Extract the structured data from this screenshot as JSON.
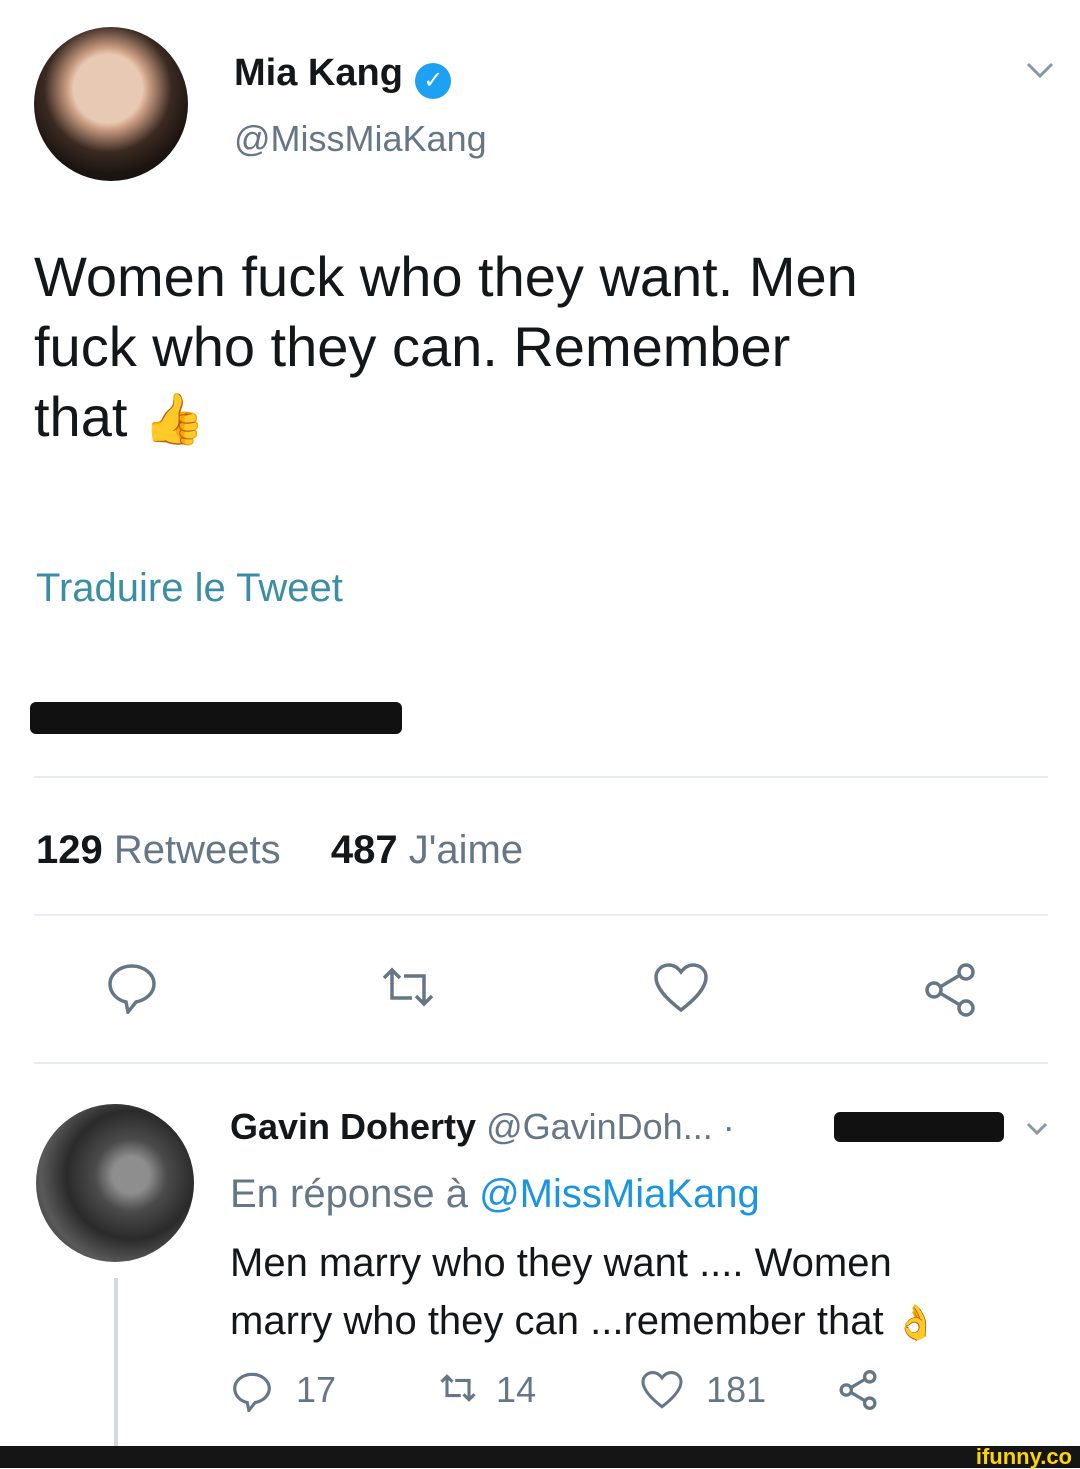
{
  "tweet": {
    "author_name": "Mia Kang",
    "author_handle": "@MissMiaKang",
    "text_line1": "Women fuck who they want. Men",
    "text_line2": "fuck who they can. Remember",
    "text_line3": "that",
    "emoji": "👍",
    "translate_label": "Traduire le Tweet",
    "retweets_count": "129",
    "retweets_label": "Retweets",
    "likes_count": "487",
    "likes_label": "J'aime",
    "icons": [
      "reply-icon",
      "retweet-icon",
      "like-icon",
      "share-icon",
      "chevron-down-icon",
      "verified-badge-icon"
    ]
  },
  "reply": {
    "author_name": "Gavin Doherty",
    "author_handle": "@GavinDoh...",
    "separator": "·",
    "in_reply_prefix": "En réponse à",
    "in_reply_handle": "@MissMiaKang",
    "text_line1": "Men marry who they want .... Women",
    "text_line2": "marry who they can ...remember that",
    "emoji": "👌",
    "reply_count": "17",
    "retweet_count": "14",
    "like_count": "181"
  },
  "watermark": "ifunny.co",
  "colors": {
    "link": "#1b95e0",
    "muted": "#657786",
    "verified": "#1da1f2",
    "watermark": "#ffd400"
  }
}
